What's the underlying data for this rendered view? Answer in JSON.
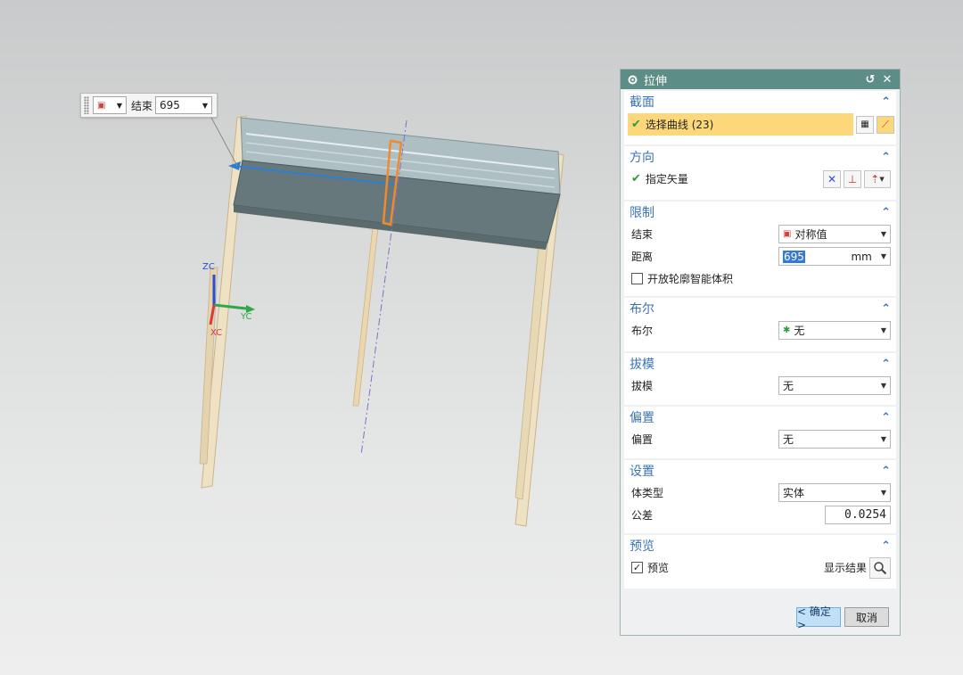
{
  "floating_input": {
    "label": "结束",
    "value": "695"
  },
  "axes": {
    "z": "ZC",
    "y": "YC",
    "x": "XC"
  },
  "dialog": {
    "title": "拉伸",
    "sections": {
      "section": {
        "title": "截面",
        "select_curve": "选择曲线 (23)"
      },
      "direction": {
        "title": "方向",
        "specify_vector": "指定矢量"
      },
      "limits": {
        "title": "限制",
        "end_label": "结束",
        "end_value": "对称值",
        "distance_label": "距离",
        "distance_value": "695",
        "distance_unit": "mm",
        "open_profile_label": "开放轮廓智能体积"
      },
      "boolean": {
        "title": "布尔",
        "label": "布尔",
        "value": "无"
      },
      "draft": {
        "title": "拔模",
        "label": "拔模",
        "value": "无"
      },
      "offset": {
        "title": "偏置",
        "label": "偏置",
        "value": "无"
      },
      "settings": {
        "title": "设置",
        "body_type_label": "体类型",
        "body_type_value": "实体",
        "tolerance_label": "公差",
        "tolerance_value": "0.0254"
      },
      "preview": {
        "title": "预览",
        "preview_label": "预览",
        "show_result_label": "显示结果"
      }
    },
    "ok_label": "< 确定 >",
    "cancel_label": "取消"
  },
  "colors": {
    "titlebar": "#5c8d86",
    "section_title": "#3a73b5",
    "selection_highlight": "#fcd87a",
    "accent": "#3678d2"
  }
}
